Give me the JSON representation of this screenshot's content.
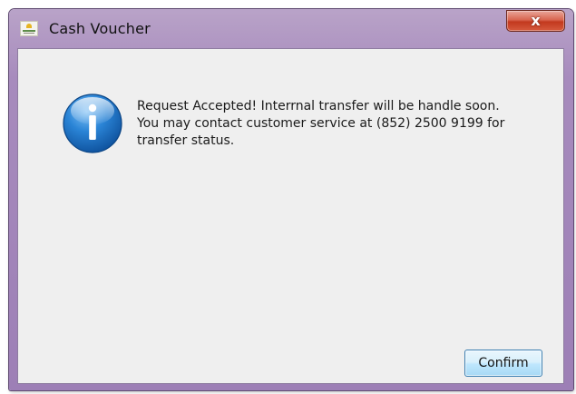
{
  "window": {
    "title": "Cash Voucher",
    "app_icon": "voucher-app-icon",
    "close_label": "x"
  },
  "dialog": {
    "icon": "info-icon",
    "message_lines": [
      "Request Accepted! Interrnal transfer will be handle soon.",
      "You may contact customer service at (852) 2500 9199 for",
      "transfer status."
    ],
    "confirm_label": "Confirm"
  },
  "colors": {
    "titlebar": "#a78bbd",
    "close_button": "#c2391e",
    "client_background": "#efefef",
    "info_icon": "#1d72c0",
    "confirm_button_border": "#3c7fb1"
  }
}
